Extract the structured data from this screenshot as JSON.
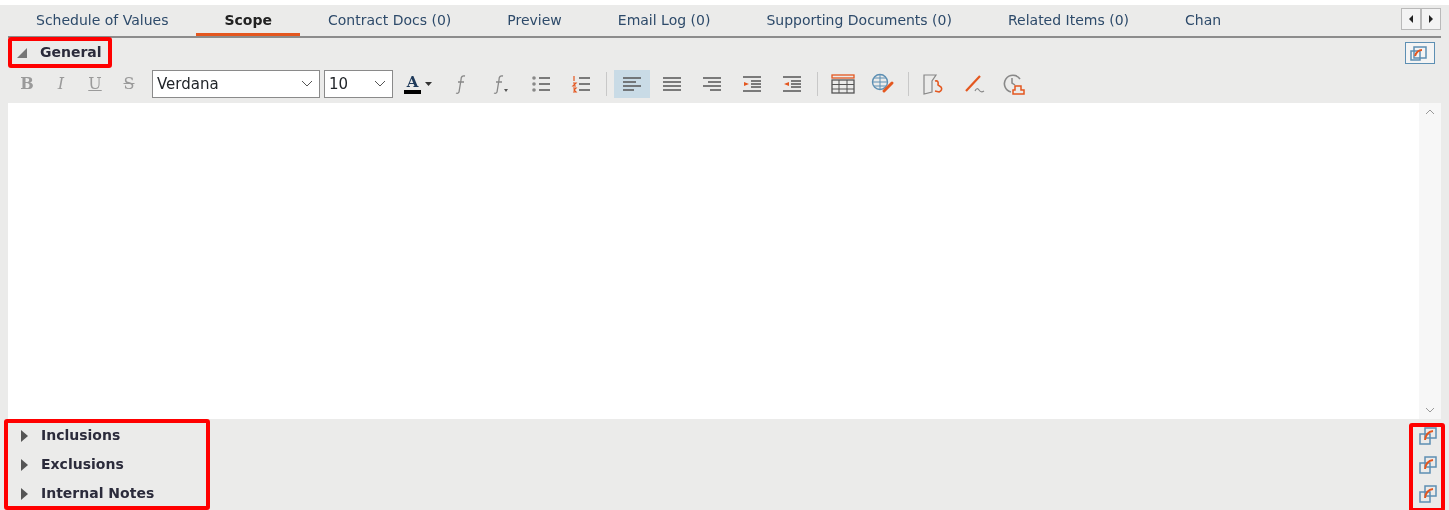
{
  "tabs": [
    {
      "label": "Schedule of Values",
      "selected": false
    },
    {
      "label": "Scope",
      "selected": true
    },
    {
      "label": "Contract Docs (0)",
      "selected": false
    },
    {
      "label": "Preview",
      "selected": false
    },
    {
      "label": "Email Log (0)",
      "selected": false
    },
    {
      "label": "Supporting Documents (0)",
      "selected": false
    },
    {
      "label": "Related Items (0)",
      "selected": false
    },
    {
      "label": "Chan",
      "selected": false
    }
  ],
  "general": {
    "title": "General",
    "expanded": true,
    "highlighted": true
  },
  "toolbar": {
    "format_buttons": [
      {
        "label": "B",
        "kind": "bold",
        "disabled": true
      },
      {
        "label": "I",
        "kind": "italic",
        "disabled": true
      },
      {
        "label": "U",
        "kind": "underline",
        "disabled": true
      },
      {
        "label": "S",
        "kind": "strike",
        "disabled": true
      }
    ],
    "font": "Verdana",
    "size": "10",
    "tools": [
      {
        "kind": "font-color",
        "label": "A"
      },
      {
        "kind": "function"
      },
      {
        "kind": "function-sub"
      },
      {
        "kind": "bullets"
      },
      {
        "kind": "numbering"
      },
      {
        "kind": "separator"
      },
      {
        "kind": "align-left",
        "selected": true
      },
      {
        "kind": "align-center",
        "selected": false
      },
      {
        "kind": "align-right",
        "selected": false
      },
      {
        "kind": "indent"
      },
      {
        "kind": "outdent"
      },
      {
        "kind": "separator"
      },
      {
        "kind": "table"
      },
      {
        "kind": "hyperlink"
      },
      {
        "kind": "separator"
      },
      {
        "kind": "stamp"
      },
      {
        "kind": "signature"
      },
      {
        "kind": "timestamp"
      }
    ]
  },
  "sections": [
    {
      "title": "Inclusions",
      "expanded": false
    },
    {
      "title": "Exclusions",
      "expanded": false
    },
    {
      "title": "Internal Notes",
      "expanded": false
    }
  ],
  "sections_highlighted": true,
  "popout_icons_highlighted": true
}
